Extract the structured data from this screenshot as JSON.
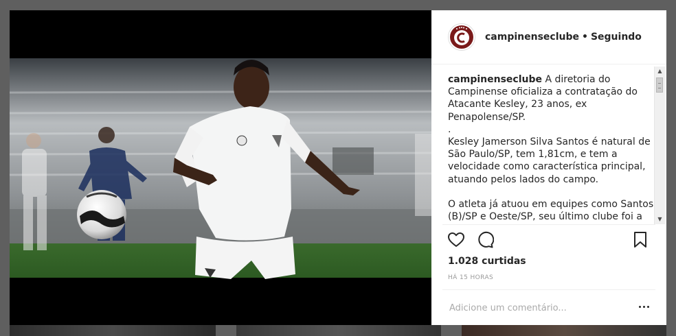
{
  "post": {
    "username": "campinenseclube",
    "separator": "•",
    "follow_status": "Seguindo",
    "caption_username": "campinenseclube",
    "caption_paragraphs": [
      "A diretoria do Campinense oficializa a contratação do Atacante Kesley, 23 anos, ex Penapolense/SP.",
      ".",
      "Kesley Jamerson Silva Santos é natural de São Paulo/SP, tem 1,81cm, e tem a velocidade como característica principal, atuando pelos lados do campo.",
      "",
      "O atleta já atuou em equipes como Santos (B)/SP e Oeste/SP, seu último clube foi a"
    ],
    "likes_text": "1.028 curtidas",
    "time_text": "Há 15 horas",
    "comment_placeholder": "Adicione um comentário..."
  },
  "icons": {
    "like": "heart-icon",
    "comment": "comment-bubble-icon",
    "save": "bookmark-icon",
    "more": "more-options-icon"
  },
  "colors": {
    "text": "#262626",
    "muted": "#999999",
    "club_red": "#7a1a1a",
    "overlay": "#5f5f5f"
  }
}
